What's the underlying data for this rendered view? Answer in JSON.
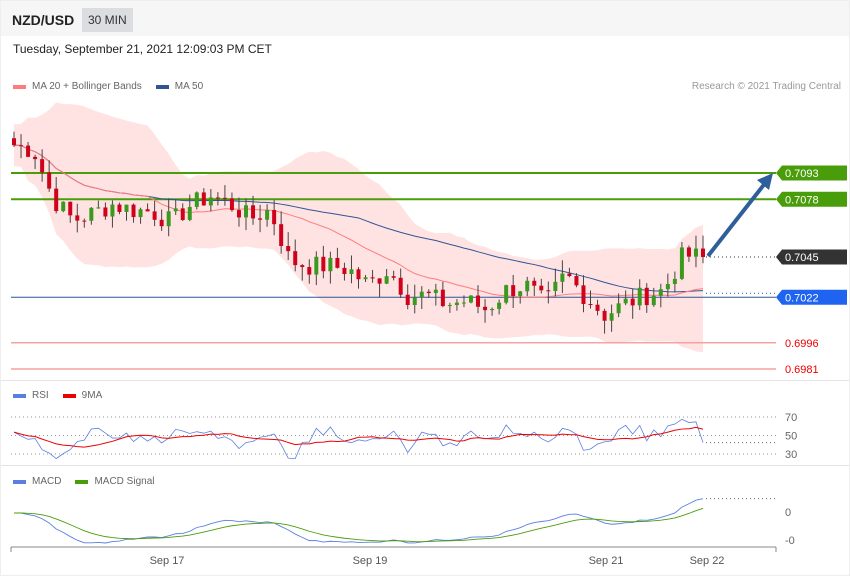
{
  "header": {
    "symbol": "NZD/USD",
    "timeframe": "30 MIN",
    "datetime": "Tuesday, September 21, 2021 12:09:03 PM CET"
  },
  "legend": {
    "ma20": "MA 20 + Bollinger Bands",
    "ma50": "MA 50",
    "rsi": "RSI",
    "rsi_ma": "9MA",
    "macd": "MACD",
    "macd_signal": "MACD Signal",
    "copyright": "Research © 2021 Trading Central"
  },
  "colors": {
    "up": "#3a9a1e",
    "down": "#d0021b",
    "ma20": "#ff7b7b",
    "ma50": "#2f5597",
    "resistance": "#4a9d0a",
    "support": "#f7a1a1",
    "current": "#333333",
    "pivot": "#1e64f0",
    "arrow": "#2f5f9b"
  },
  "chart_data": {
    "type": "candlestick",
    "title": "NZD/USD 30 MIN",
    "price_range": [
      0.6975,
      0.7125
    ],
    "close_anchors": [
      0.7109,
      0.7106,
      0.7078,
      0.7066,
      0.707,
      0.7075,
      0.7072,
      0.7071,
      0.7065,
      0.7075,
      0.708,
      0.7075,
      0.7067,
      0.7072,
      0.7043,
      0.704,
      0.704,
      0.7038,
      0.7029,
      0.7038,
      0.7023,
      0.7023,
      0.7018,
      0.702,
      0.7015,
      0.7026,
      0.7029,
      0.7018,
      0.7035,
      0.7023,
      0.7012,
      0.7018,
      0.7023,
      0.7026,
      0.7046,
      0.7045
    ],
    "levels": [
      {
        "label": "0.7093",
        "value": 0.7093,
        "kind": "resistance"
      },
      {
        "label": "0.7078",
        "value": 0.7078,
        "kind": "resistance"
      },
      {
        "label": "0.7045",
        "value": 0.7045,
        "kind": "current"
      },
      {
        "label": "0.7022",
        "value": 0.7022,
        "kind": "pivot"
      },
      {
        "label": "0.6996",
        "value": 0.6996,
        "kind": "support"
      },
      {
        "label": "0.6981",
        "value": 0.6981,
        "kind": "support"
      }
    ],
    "rsi": {
      "ticks": [
        "70",
        "50",
        "30"
      ],
      "tick_values": [
        70,
        50,
        30
      ]
    },
    "macd": {
      "ticks": [
        "0",
        "-0"
      ]
    },
    "x_ticks": [
      "Sep 17",
      "Sep 19",
      "Sep 21",
      "Sep 22"
    ]
  }
}
